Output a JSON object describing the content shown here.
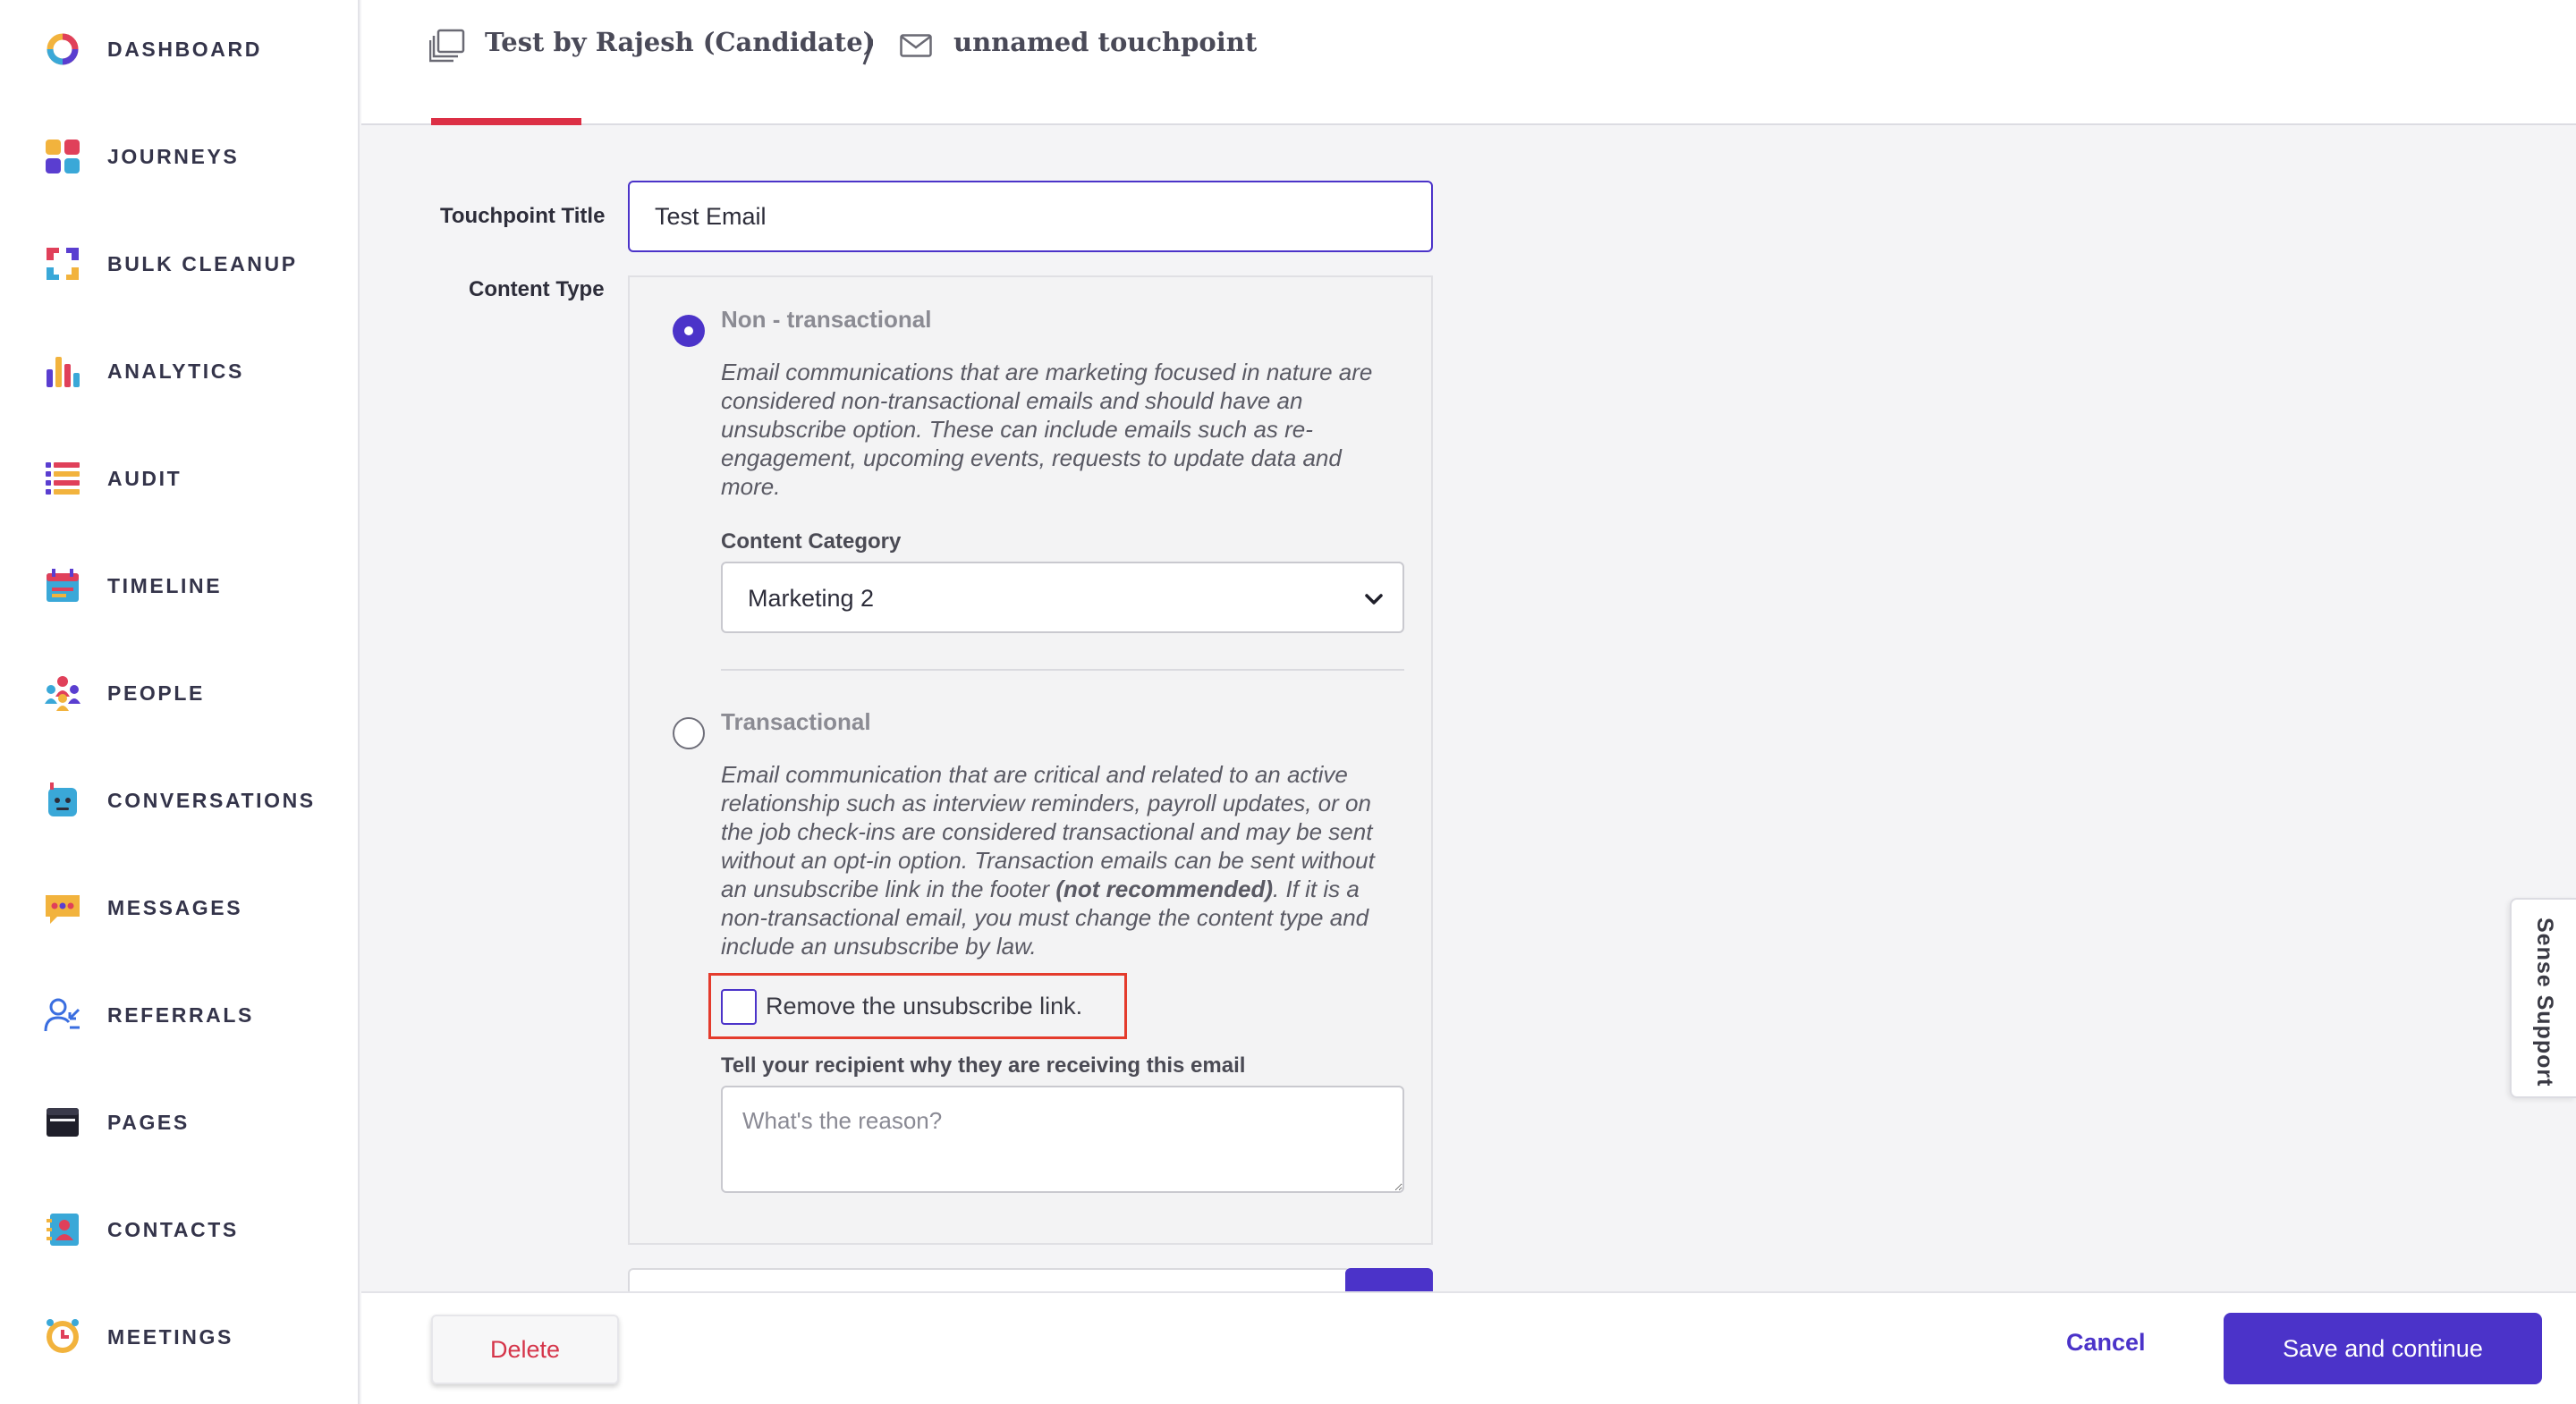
{
  "sidebar": {
    "items": [
      {
        "label": "DASHBOARD",
        "icon": "dashboard-ring-icon"
      },
      {
        "label": "JOURNEYS",
        "icon": "journeys-grid-icon"
      },
      {
        "label": "BULK CLEANUP",
        "icon": "bulk-cleanup-arrows-icon"
      },
      {
        "label": "ANALYTICS",
        "icon": "analytics-bars-icon"
      },
      {
        "label": "AUDIT",
        "icon": "audit-list-icon"
      },
      {
        "label": "TIMELINE",
        "icon": "timeline-calendar-icon"
      },
      {
        "label": "PEOPLE",
        "icon": "people-group-icon"
      },
      {
        "label": "CONVERSATIONS",
        "icon": "conversations-bot-icon"
      },
      {
        "label": "MESSAGES",
        "icon": "messages-bubble-icon"
      },
      {
        "label": "REFERRALS",
        "icon": "referrals-person-icon"
      },
      {
        "label": "PAGES",
        "icon": "pages-browser-icon"
      },
      {
        "label": "CONTACTS",
        "icon": "contacts-card-icon"
      },
      {
        "label": "MEETINGS",
        "icon": "meetings-clock-icon"
      }
    ]
  },
  "header": {
    "journey_title": "Test by Rajesh (Candidate)",
    "touchpoint_title": "unnamed touchpoint"
  },
  "form": {
    "title_label": "Touchpoint Title",
    "title_value": "Test Email",
    "content_type_label": "Content Type",
    "non_transactional": {
      "title": "Non - transactional",
      "selected": true,
      "description": "Email communications that are marketing focused in nature are considered non-transactional emails and should have an unsubscribe option. These can include emails such as re-engagement, upcoming events, requests to update data and more.",
      "category_label": "Content Category",
      "category_value": "Marketing 2"
    },
    "transactional": {
      "title": "Transactional",
      "selected": false,
      "description_part1": "Email communication that are critical and related to an active relationship such as interview reminders, payroll updates, or on the job check-ins are considered transactional and may be sent without an opt-in option. Transaction emails can be sent without an unsubscribe link in the footer ",
      "description_emphasis": "(not recommended)",
      "description_part2": ". If it is a non-transactional email, you must change the content type and include an unsubscribe by law.",
      "checkbox_label": "Remove the unsubscribe link.",
      "checkbox_checked": false,
      "reason_label": "Tell your recipient why they are receiving this email",
      "reason_placeholder": "What's the reason?"
    }
  },
  "footer": {
    "delete_label": "Delete",
    "cancel_label": "Cancel",
    "save_label": "Save and continue"
  },
  "support": {
    "label": "Sense Support"
  },
  "colors": {
    "accent": "#4b33c9",
    "danger": "#d5354a",
    "highlight": "#e43b2c"
  }
}
